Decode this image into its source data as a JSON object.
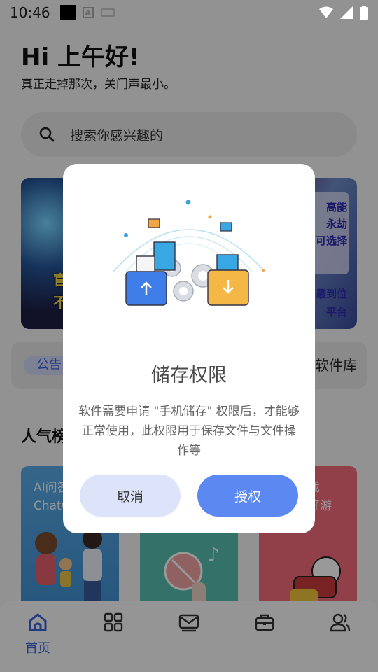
{
  "status_bar": {
    "time": "10:46",
    "keyboard_badge": "A"
  },
  "header": {
    "greeting": "Hi 上午好!",
    "subtitle": "真正走掉那次，关门声最小。"
  },
  "search": {
    "placeholder": "搜索你感兴趣的"
  },
  "banner": {
    "left_text_1": "官",
    "left_text_2": "不",
    "right_lines": [
      "高能",
      "永劫",
      "可选择",
      "最到位",
      "平台"
    ]
  },
  "notice": {
    "tag": "公告",
    "text": "软件库"
  },
  "popular": {
    "title": "人气榜",
    "cards": [
      {
        "text_line1": "AI问答",
        "text_line2": "ChatG"
      },
      {
        "text_line1": "",
        "text_line2": ""
      },
      {
        "text_line1": "戏",
        "text_line2": "好游"
      }
    ]
  },
  "bottom_nav": {
    "items": [
      {
        "label": "首页",
        "icon": "home-icon",
        "active": true
      },
      {
        "label": "",
        "icon": "grid-icon"
      },
      {
        "label": "",
        "icon": "mail-icon"
      },
      {
        "label": "",
        "icon": "toolbox-icon"
      },
      {
        "label": "",
        "icon": "users-icon"
      }
    ],
    "active_color": "#3d5fd6"
  },
  "dialog": {
    "title": "储存权限",
    "body": "软件需要申请 \"手机储存\" 权限后，才能够正常使用，此权限用于保存文件与文件操作等",
    "cancel_label": "取消",
    "grant_label": "授权",
    "grant_color": "#5c89f1",
    "cancel_color": "#dde4fa"
  }
}
